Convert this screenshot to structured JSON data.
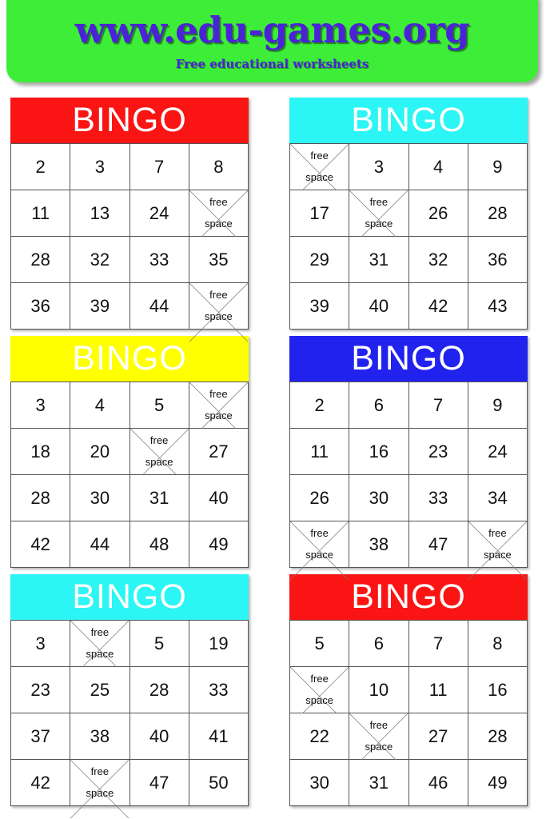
{
  "banner": {
    "title": "www.edu-games.org",
    "subtitle": "Free educational worksheets",
    "background_color": "#3ded38",
    "text_color": "#4b22d8"
  },
  "free_space": {
    "line1": "free",
    "line2": "space"
  },
  "cards": [
    {
      "title": "BINGO",
      "header_color": "#fa1414",
      "rows": [
        [
          "2",
          "3",
          "7",
          "8"
        ],
        [
          "11",
          "13",
          "24",
          "FREE"
        ],
        [
          "28",
          "32",
          "33",
          "35"
        ],
        [
          "36",
          "39",
          "44",
          "FREE"
        ]
      ]
    },
    {
      "title": "BINGO",
      "header_color": "#2bf5f5",
      "rows": [
        [
          "FREE",
          "3",
          "4",
          "9"
        ],
        [
          "17",
          "FREE",
          "26",
          "28"
        ],
        [
          "29",
          "31",
          "32",
          "36"
        ],
        [
          "39",
          "40",
          "42",
          "43"
        ]
      ]
    },
    {
      "title": "BINGO",
      "header_color": "#ffff00",
      "rows": [
        [
          "3",
          "4",
          "5",
          "FREE"
        ],
        [
          "18",
          "20",
          "FREE",
          "27"
        ],
        [
          "28",
          "30",
          "31",
          "40"
        ],
        [
          "42",
          "44",
          "48",
          "49"
        ]
      ]
    },
    {
      "title": "BINGO",
      "header_color": "#2222ee",
      "rows": [
        [
          "2",
          "6",
          "7",
          "9"
        ],
        [
          "11",
          "16",
          "23",
          "24"
        ],
        [
          "26",
          "30",
          "33",
          "34"
        ],
        [
          "FREE",
          "38",
          "47",
          "FREE"
        ]
      ]
    },
    {
      "title": "BINGO",
      "header_color": "#2bf5f5",
      "rows": [
        [
          "3",
          "FREE",
          "5",
          "19"
        ],
        [
          "23",
          "25",
          "28",
          "33"
        ],
        [
          "37",
          "38",
          "40",
          "41"
        ],
        [
          "42",
          "FREE",
          "47",
          "50"
        ]
      ]
    },
    {
      "title": "BINGO",
      "header_color": "#fa1414",
      "rows": [
        [
          "5",
          "6",
          "7",
          "8"
        ],
        [
          "FREE",
          "10",
          "11",
          "16"
        ],
        [
          "22",
          "FREE",
          "27",
          "28"
        ],
        [
          "30",
          "31",
          "46",
          "49"
        ]
      ]
    }
  ]
}
